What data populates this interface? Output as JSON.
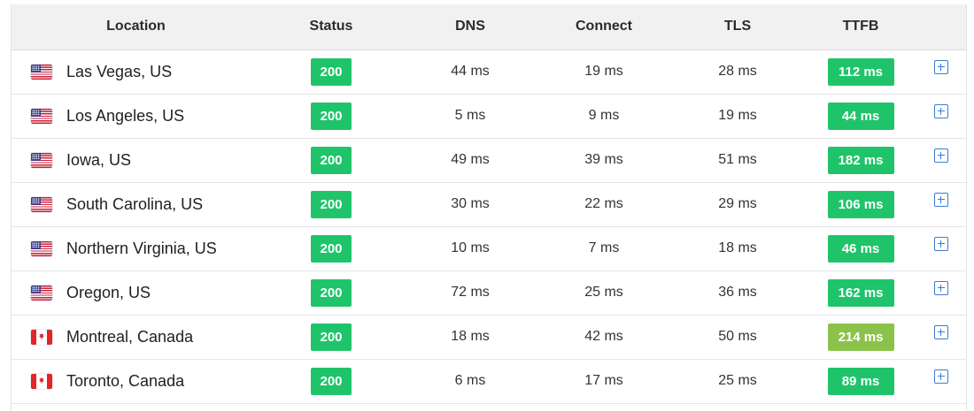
{
  "headers": [
    "Location",
    "Status",
    "DNS",
    "Connect",
    "TLS",
    "TTFB",
    ""
  ],
  "colors": {
    "status_ok": "#1fc46a",
    "ttfb_fast": "#1fc46a",
    "ttfb_slower": "#8bc34a",
    "expand_icon": "#3a7bd5"
  },
  "rows": [
    {
      "flag": "us",
      "location": "Las Vegas, US",
      "status": "200",
      "dns": "44 ms",
      "connect": "19 ms",
      "tls": "28 ms",
      "ttfb": "112 ms"
    },
    {
      "flag": "us",
      "location": "Los Angeles, US",
      "status": "200",
      "dns": "5 ms",
      "connect": "9 ms",
      "tls": "19 ms",
      "ttfb": "44 ms"
    },
    {
      "flag": "us",
      "location": "Iowa, US",
      "status": "200",
      "dns": "49 ms",
      "connect": "39 ms",
      "tls": "51 ms",
      "ttfb": "182 ms"
    },
    {
      "flag": "us",
      "location": "South Carolina, US",
      "status": "200",
      "dns": "30 ms",
      "connect": "22 ms",
      "tls": "29 ms",
      "ttfb": "106 ms"
    },
    {
      "flag": "us",
      "location": "Northern Virginia, US",
      "status": "200",
      "dns": "10 ms",
      "connect": "7 ms",
      "tls": "18 ms",
      "ttfb": "46 ms"
    },
    {
      "flag": "us",
      "location": "Oregon, US",
      "status": "200",
      "dns": "72 ms",
      "connect": "25 ms",
      "tls": "36 ms",
      "ttfb": "162 ms"
    },
    {
      "flag": "ca",
      "location": "Montreal, Canada",
      "status": "200",
      "dns": "18 ms",
      "connect": "42 ms",
      "tls": "50 ms",
      "ttfb": "214 ms",
      "ttfb_slow": true
    },
    {
      "flag": "ca",
      "location": "Toronto, Canada",
      "status": "200",
      "dns": "6 ms",
      "connect": "17 ms",
      "tls": "25 ms",
      "ttfb": "89 ms"
    }
  ]
}
